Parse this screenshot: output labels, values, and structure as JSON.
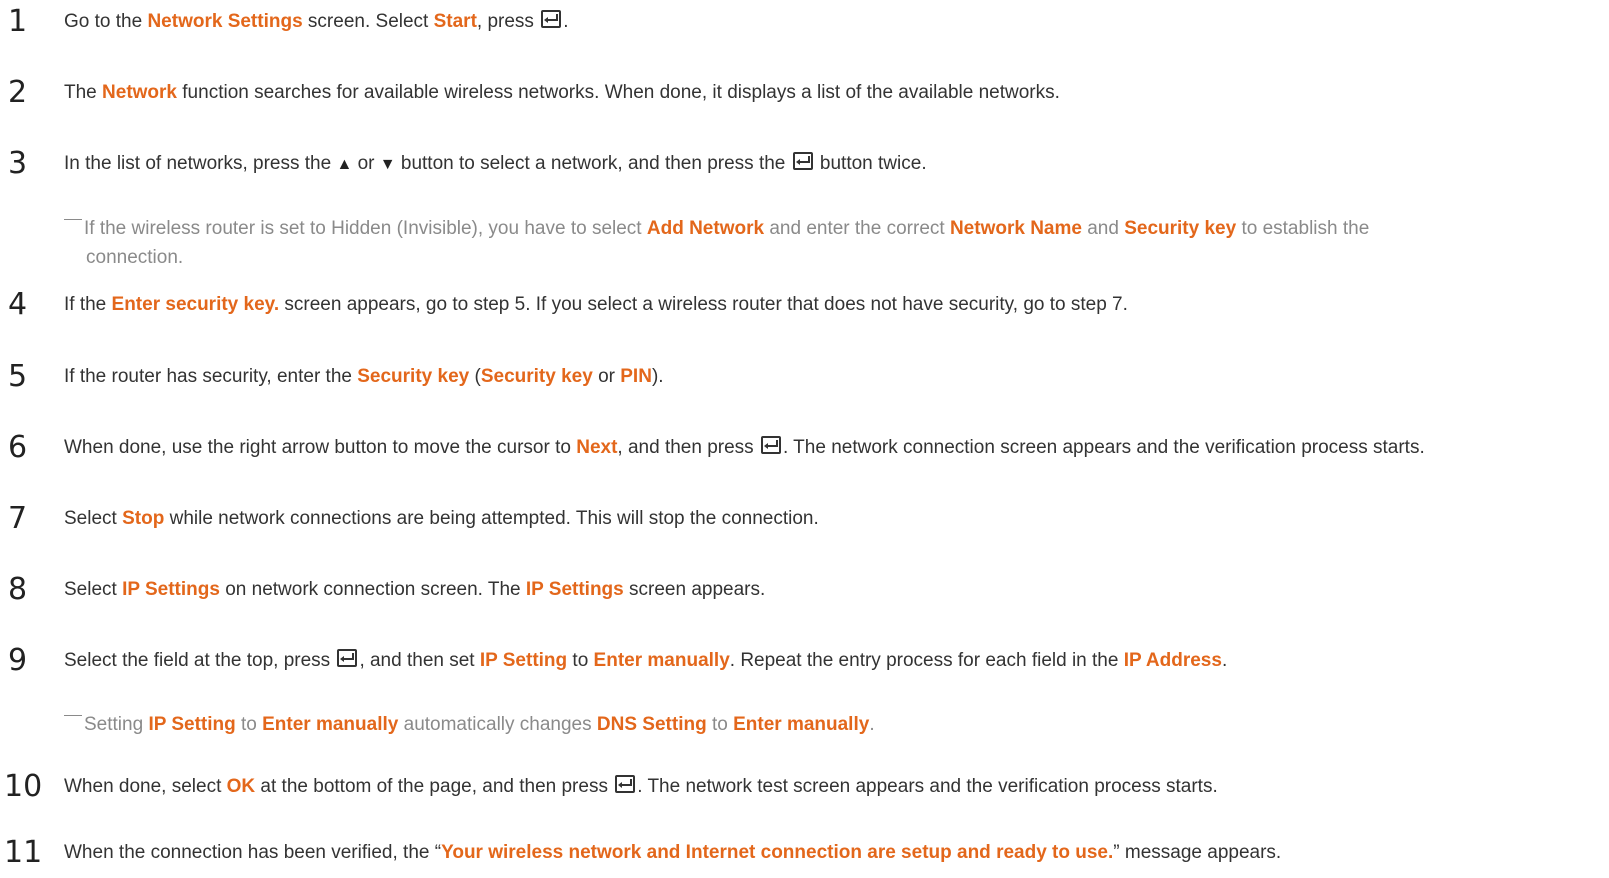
{
  "steps": [
    {
      "n": "1",
      "parts": [
        "Go to the ",
        "Network Settings",
        " screen. Select ",
        "Start",
        ", press "
      ]
    },
    {
      "n": "2",
      "parts": [
        "The ",
        "Network",
        " function searches for available wireless networks. When done, it displays a list of the available networks."
      ]
    },
    {
      "n": "3",
      "parts": [
        "In the list of networks, press the ",
        "▲",
        " or ",
        "▼",
        " button to select a network, and then press the ",
        "button twice."
      ]
    },
    {
      "n": "4",
      "parts": [
        "If the ",
        "Enter security key.",
        " screen appears, go to step 5. If you select a wireless router that does not have security, go to step 7."
      ]
    },
    {
      "n": "5",
      "parts": [
        "If the router has security, enter the ",
        "Security key",
        " (",
        "Security key",
        " or ",
        "PIN",
        ")."
      ]
    },
    {
      "n": "6",
      "parts": [
        "When done, use the right arrow button to move the cursor to ",
        "Next",
        ", and then press ",
        ". The network connection screen appears and the verification process starts."
      ]
    },
    {
      "n": "7",
      "parts": [
        "Select ",
        "Stop",
        " while network connections are being attempted. This will stop the connection."
      ]
    },
    {
      "n": "8",
      "parts": [
        "Select ",
        "IP Settings",
        " on network connection screen. The ",
        "IP Settings",
        " screen appears."
      ]
    },
    {
      "n": "9",
      "parts": [
        "Select the field at the top, press ",
        ", and then set ",
        "IP Setting",
        " to ",
        "Enter manually",
        ". Repeat the entry process for each field in the ",
        "IP Address",
        "."
      ]
    },
    {
      "n": "10",
      "parts": [
        "When done, select ",
        "OK",
        " at the bottom of the page, and then press ",
        ". The network test screen appears and the verification process starts."
      ]
    },
    {
      "n": "11",
      "parts": [
        "When the connection has been verified, the “",
        "Your wireless network and Internet connection are setup and ready to use.",
        "” message appears."
      ]
    }
  ],
  "notes": {
    "hidden_router": [
      "If the wireless router is set to Hidden (Invisible), you have to select ",
      "Add Network",
      " and enter the correct ",
      "Network Name",
      " and ",
      "Security key",
      " to establish the",
      "connection."
    ],
    "ip_setting": [
      "Setting ",
      "IP Setting",
      " to ",
      "Enter manually",
      " automatically changes ",
      "DNS Setting",
      " to ",
      "Enter manually",
      "."
    ]
  },
  "colors": {
    "highlight": "#e3671b",
    "note": "#8a8a8a",
    "text": "#333333"
  },
  "icons": {
    "enter": "enter-key-icon"
  }
}
